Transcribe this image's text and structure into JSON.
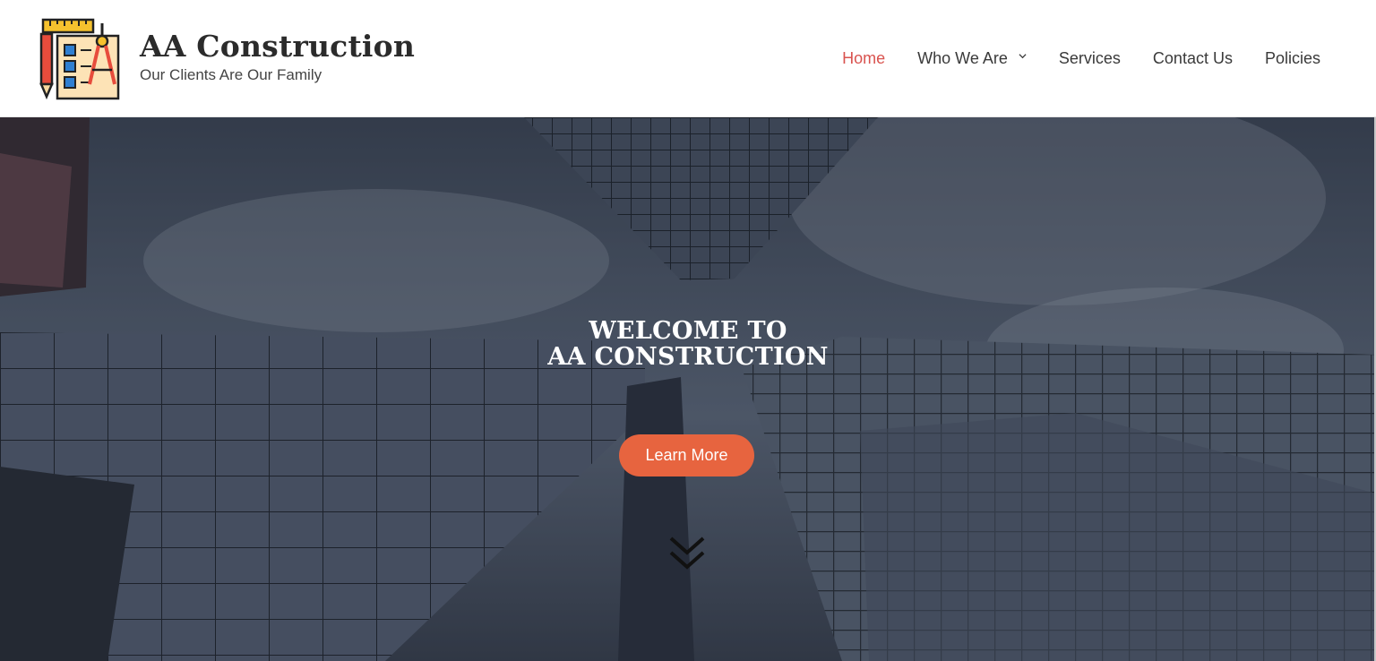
{
  "brand": {
    "title": "AA Construction",
    "tagline": "Our Clients Are Our Family",
    "logo_icon": "blueprint-ruler-compass-icon"
  },
  "nav": {
    "items": [
      {
        "label": "Home",
        "active": true
      },
      {
        "label": "Who We Are",
        "has_dropdown": true
      },
      {
        "label": "Services"
      },
      {
        "label": "Contact Us"
      },
      {
        "label": "Policies"
      }
    ]
  },
  "hero": {
    "title_line1": "WELCOME TO",
    "title_line2": "AA CONSTRUCTION",
    "cta_label": "Learn More",
    "scroll_icon": "double-chevron-down-icon"
  },
  "colors": {
    "accent": "#e7643f",
    "active_nav": "#d9534f",
    "text": "#3a3a3a"
  }
}
